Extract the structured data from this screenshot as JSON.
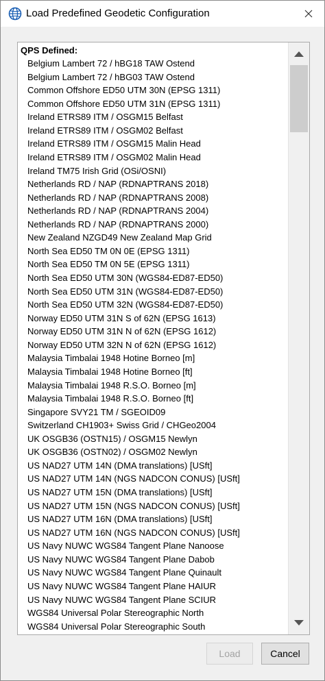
{
  "window": {
    "title": "Load Predefined Geodetic Configuration",
    "app_icon": "globe-icon",
    "close_icon": "close-icon"
  },
  "list": {
    "group_header": "QPS Defined:",
    "items": [
      "Belgium Lambert 72 / hBG18 TAW Ostend",
      "Belgium Lambert 72 / hBG03 TAW Ostend",
      "Common Offshore ED50 UTM 30N (EPSG 1311)",
      "Common Offshore ED50 UTM 31N (EPSG 1311)",
      "Ireland ETRS89 ITM / OSGM15 Belfast",
      "Ireland ETRS89 ITM / OSGM02 Belfast",
      "Ireland ETRS89 ITM / OSGM15 Malin Head",
      "Ireland ETRS89 ITM / OSGM02 Malin Head",
      "Ireland TM75 Irish Grid (OSi/OSNI)",
      "Netherlands RD / NAP (RDNAPTRANS 2018)",
      "Netherlands RD / NAP (RDNAPTRANS 2008)",
      "Netherlands RD / NAP (RDNAPTRANS 2004)",
      "Netherlands RD / NAP (RDNAPTRANS 2000)",
      "New Zealand NZGD49 New Zealand Map Grid",
      "North Sea ED50 TM 0N 0E (EPSG 1311)",
      "North Sea ED50 TM 0N 5E (EPSG 1311)",
      "North Sea ED50 UTM 30N (WGS84-ED87-ED50)",
      "North Sea ED50 UTM 31N (WGS84-ED87-ED50)",
      "North Sea ED50 UTM 32N (WGS84-ED87-ED50)",
      "Norway ED50 UTM 31N S of 62N (EPSG 1613)",
      "Norway ED50 UTM 31N N of 62N (EPSG 1612)",
      "Norway ED50 UTM 32N N of 62N (EPSG 1612)",
      "Malaysia Timbalai 1948 Hotine Borneo [m]",
      "Malaysia Timbalai 1948 Hotine Borneo [ft]",
      "Malaysia Timbalai 1948 R.S.O. Borneo [m]",
      "Malaysia Timbalai 1948 R.S.O. Borneo [ft]",
      "Singapore SVY21 TM / SGEOID09",
      "Switzerland CH1903+ Swiss Grid / CHGeo2004",
      "UK OSGB36 (OSTN15) / OSGM15 Newlyn",
      "UK OSGB36 (OSTN02) / OSGM02 Newlyn",
      "US NAD27 UTM 14N (DMA translations) [USft]",
      "US NAD27 UTM 14N (NGS NADCON CONUS) [USft]",
      "US NAD27 UTM 15N (DMA translations) [USft]",
      "US NAD27 UTM 15N (NGS NADCON CONUS) [USft]",
      "US NAD27 UTM 16N (DMA translations) [USft]",
      "US NAD27 UTM 16N (NGS NADCON CONUS) [USft]",
      "US Navy NUWC WGS84 Tangent Plane Nanoose",
      "US Navy NUWC WGS84 Tangent Plane Dabob",
      "US Navy NUWC WGS84 Tangent Plane Quinault",
      "US Navy NUWC WGS84 Tangent Plane HAIUR",
      "US Navy NUWC WGS84 Tangent Plane SCIUR",
      "WGS84 Universal Polar Stereographic North",
      "WGS84 Universal Polar Stereographic South"
    ]
  },
  "scrollbar": {
    "up_icon": "arrow-up-icon",
    "down_icon": "arrow-down-icon"
  },
  "buttons": {
    "load_label": "Load",
    "load_enabled": false,
    "cancel_label": "Cancel"
  }
}
